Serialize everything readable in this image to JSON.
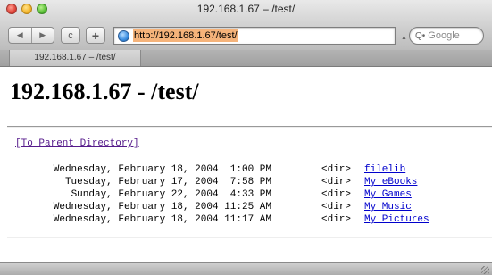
{
  "window": {
    "title": "192.168.1.67 – /test/"
  },
  "toolbar": {
    "back_glyph": "◀",
    "forward_glyph": "▶",
    "reload_glyph": "c",
    "add_bookmark_glyph": "+",
    "url": "http://192.168.1.67/test/",
    "search_placeholder": "Google",
    "search_icon": "Q•",
    "search_dropdown_glyph": "▲"
  },
  "tabs": [
    {
      "label": "192.168.1.67 – /test/",
      "active": true
    }
  ],
  "page": {
    "heading": "192.168.1.67 - /test/",
    "parent_link": "[To Parent Directory]",
    "entries": [
      {
        "date": "Wednesday, February 18, 2004  1:00 PM",
        "type": "<dir>",
        "name": "filelib"
      },
      {
        "date": "Tuesday, February 17, 2004  7:58 PM",
        "type": "<dir>",
        "name": "My eBooks"
      },
      {
        "date": "Sunday, February 22, 2004  4:33 PM",
        "type": "<dir>",
        "name": "My Games"
      },
      {
        "date": "Wednesday, February 18, 2004 11:25 AM",
        "type": "<dir>",
        "name": "My Music"
      },
      {
        "date": "Wednesday, February 18, 2004 11:17 AM",
        "type": "<dir>",
        "name": "My Pictures"
      }
    ]
  },
  "colors": {
    "url_highlight": "#f5b37a",
    "link": "#0000cc",
    "visited_link": "#551a8b"
  }
}
